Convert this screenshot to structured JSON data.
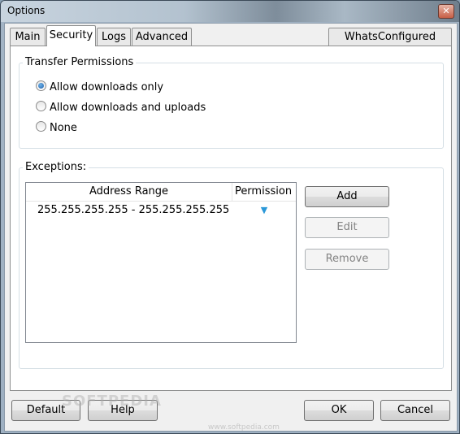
{
  "window": {
    "title": "Options",
    "close_glyph": "✕"
  },
  "tabs": [
    {
      "label": "Main",
      "active": false
    },
    {
      "label": "Security",
      "active": true
    },
    {
      "label": "Logs",
      "active": false
    },
    {
      "label": "Advanced",
      "active": false
    }
  ],
  "whats_configured_label": "WhatsConfigured",
  "transfer_permissions": {
    "label": "Transfer Permissions",
    "options": [
      {
        "label": "Allow downloads only",
        "checked": true
      },
      {
        "label": "Allow downloads and uploads",
        "checked": false
      },
      {
        "label": "None",
        "checked": false
      }
    ]
  },
  "exceptions": {
    "label": "Exceptions:",
    "columns": [
      "Address Range",
      "Permission"
    ],
    "rows": [
      {
        "range": "255.255.255.255 - 255.255.255.255",
        "permission_icon": "▼"
      }
    ],
    "buttons": {
      "add": "Add",
      "edit": "Edit",
      "remove": "Remove"
    }
  },
  "footer": {
    "default": "Default",
    "help": "Help",
    "ok": "OK",
    "cancel": "Cancel"
  },
  "watermark": {
    "main": "SOFTPEDIA",
    "url": "www.softpedia.com"
  },
  "colors": {
    "accent": "#2b98d8",
    "radio_selected": "#1f5fa8"
  }
}
